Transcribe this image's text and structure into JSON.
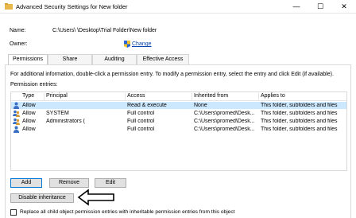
{
  "window": {
    "title": "Advanced Security Settings for New folder",
    "minimize": "—",
    "maximize": "☐",
    "close": "✕"
  },
  "fields": {
    "name_label": "Name:",
    "name_value": "C:\\Users\\     \\Desktop\\Trial Folder\\New folder",
    "owner_label": "Owner:",
    "owner_link": "Change"
  },
  "tabs": [
    {
      "label": "Permissions"
    },
    {
      "label": "Share"
    },
    {
      "label": "Auditing"
    },
    {
      "label": "Effective Access"
    }
  ],
  "panel": {
    "info": "For additional information, double-click a permission entry. To modify a permission entry, select the entry and click Edit (if available).",
    "entries_label": "Permission entries:"
  },
  "table": {
    "headers": [
      "Type",
      "Principal",
      "Access",
      "Inherited from",
      "Applies to"
    ],
    "rows": [
      {
        "type": "Allow",
        "principal": "",
        "access": "Read & execute",
        "inherited": "None",
        "applies": "This folder, subfolders and files"
      },
      {
        "type": "Allow",
        "principal": "SYSTEM",
        "access": "Full control",
        "inherited": "C:\\Users\\promed\\Desk...",
        "applies": "This folder, subfolders and files"
      },
      {
        "type": "Allow",
        "principal": "Administrators (",
        "access": "Full control",
        "inherited": "C:\\Users\\promed\\Desk...",
        "applies": "This folder, subfolders and files"
      },
      {
        "type": "Allow",
        "principal": "",
        "access": "Full control",
        "inherited": "C:\\Users\\promed\\Desk...",
        "applies": "This folder, subfolders and files"
      }
    ]
  },
  "buttons": {
    "add": "Add",
    "remove": "Remove",
    "edit": "Edit",
    "disable_inheritance": "Disable inheritance"
  },
  "checkbox": {
    "label": "Replace all child object permission entries with inheritable permission entries from this object"
  },
  "colors": {
    "selection": "#cce8ff",
    "link": "#0645ad",
    "focus_border": "#0078d7"
  }
}
